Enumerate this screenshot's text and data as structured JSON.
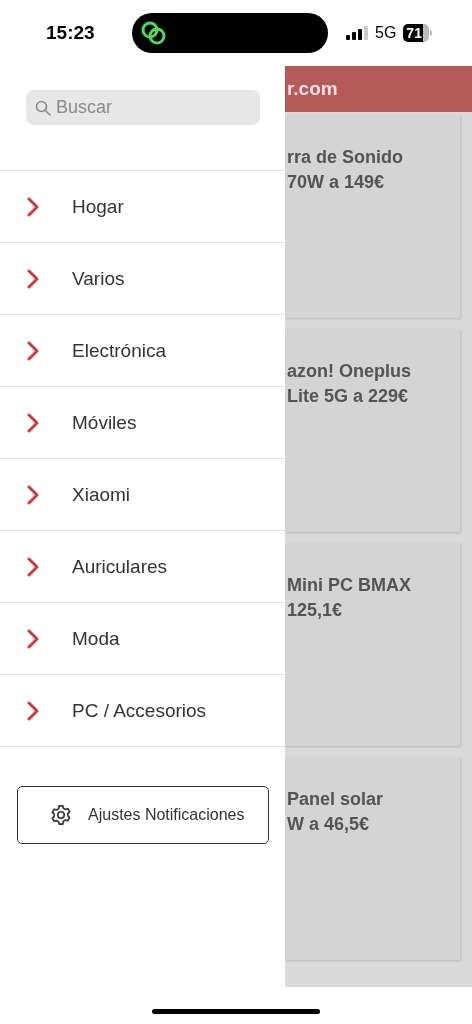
{
  "status_bar": {
    "time": "15:23",
    "network": "5G",
    "battery": "71"
  },
  "drawer": {
    "search": {
      "placeholder": "Buscar"
    },
    "items": [
      {
        "label": "Hogar"
      },
      {
        "label": "Varios"
      },
      {
        "label": "Electrónica"
      },
      {
        "label": "Móviles"
      },
      {
        "label": "Xiaomi"
      },
      {
        "label": "Auriculares"
      },
      {
        "label": "Moda"
      },
      {
        "label": "PC / Accesorios"
      }
    ],
    "settings_button": "Ajustes Notificaciones"
  },
  "background_page": {
    "header_title": "r.com",
    "cards": [
      {
        "title_lines": [
          "rra de Sonido",
          "70W a 149€"
        ]
      },
      {
        "title_lines": [
          "azon! Oneplus",
          "Lite 5G a 229€"
        ]
      },
      {
        "title_lines": [
          "Mini PC BMAX",
          "125,1€"
        ]
      },
      {
        "title_lines": [
          "Panel solar",
          "W a 46,5€"
        ]
      }
    ]
  }
}
